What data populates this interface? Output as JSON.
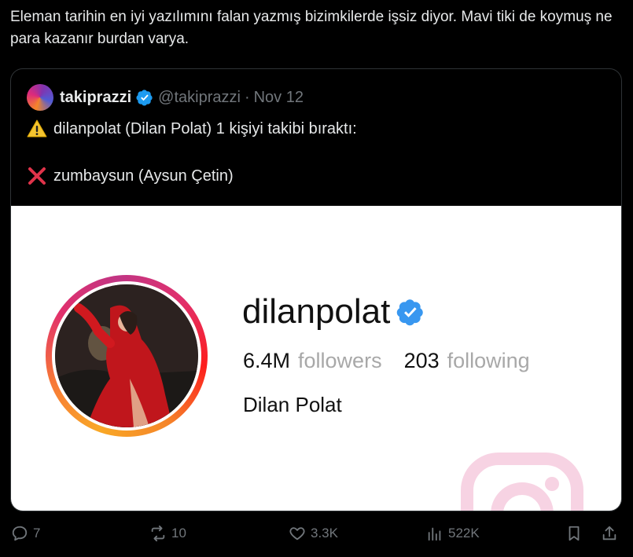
{
  "post": {
    "text": "Eleman tarihin en iyi yazılımını falan yazmış bizimkilerde işsiz diyor. Mavi tiki de koymuş ne para kazanır burdan varya."
  },
  "quote": {
    "name": "takiprazzi",
    "handle": "@takiprazzi",
    "separator": "·",
    "date": "Nov 12",
    "line1": "dilanpolat (Dilan Polat) 1 kişiyi takibi bıraktı:",
    "line2": "zumbaysun (Aysun Çetin)",
    "line1_icon": "warning-icon",
    "line2_icon": "cross-mark-icon"
  },
  "card": {
    "username": "dilanpolat",
    "followers_count": "6.4M",
    "followers_label": "followers",
    "following_count": "203",
    "following_label": "following",
    "full_name": "Dilan Polat"
  },
  "actions": {
    "replies": "7",
    "reposts": "10",
    "likes": "3.3K",
    "views": "522K"
  },
  "colors": {
    "background": "#000000",
    "text": "#e7e9ea",
    "muted": "#71767b",
    "verified": "#1d9bf0",
    "card_bg": "#ffffff"
  }
}
